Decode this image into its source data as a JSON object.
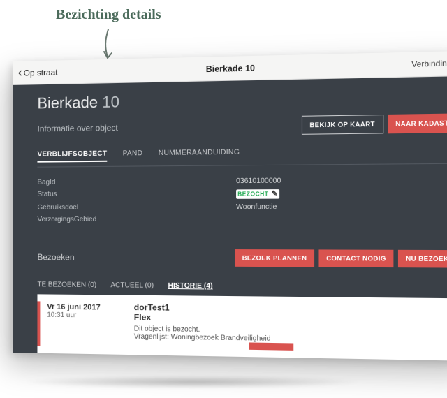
{
  "annotation": "Bezichting details",
  "topbar": {
    "back": "Op straat",
    "title": "Bierkade 10",
    "connection": "Verbinding actief"
  },
  "header": {
    "street": "Bierkade",
    "number": "10",
    "subtitle": "Informatie over object",
    "map_button": "BEKIJK OP KAART",
    "kadaster_button": "NAAR KADASTER"
  },
  "object_tabs": {
    "items": [
      "VERBLIJFSOBJECT",
      "PAND",
      "NUMMERAANDUIDING"
    ],
    "active_index": 0
  },
  "properties": {
    "labels": {
      "bagid": "BagId",
      "status": "Status",
      "gebruiksdoel": "Gebruiksdoel",
      "verzorgingsgebied": "VerzorgingsGebied"
    },
    "values": {
      "bagid": "03610100000",
      "status_badge": "BEZOCHT",
      "gebruiksdoel": "Woonfunctie",
      "verzorgingsgebied": ""
    }
  },
  "visits": {
    "heading": "Bezoeken",
    "buttons": {
      "plan": "BEZOEK PLANNEN",
      "contact": "CONTACT NODIG",
      "now": "NU BEZOEKEN"
    },
    "tabs": {
      "items": [
        "TE BEZOEKEN (0)",
        "ACTUEEL (0)",
        "HISTORIE (4)"
      ],
      "active_index": 2
    },
    "card": {
      "date": "Vr 16 juni 2017",
      "time": "10:31 uur",
      "title1": "dorTest1",
      "title2": "Flex",
      "line1": "Dit object is bezocht.",
      "line2": "Vragenlijst: Woningbezoek Brandveiligheid"
    }
  }
}
